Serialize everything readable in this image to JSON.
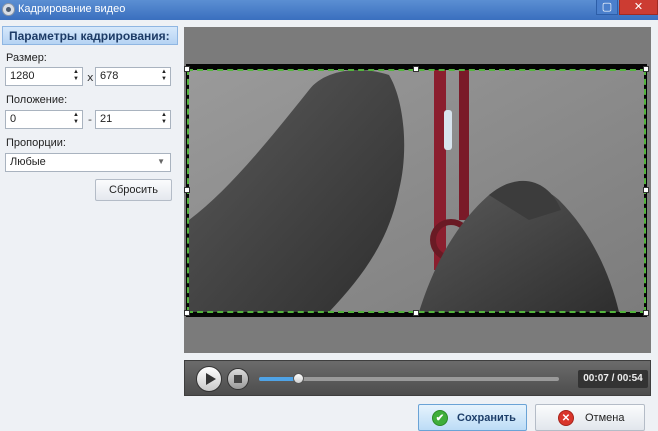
{
  "window": {
    "title": "Кадрирование видео",
    "controls": {
      "maximize_icon": "maximize-icon",
      "close_icon": "close-icon"
    }
  },
  "panel": {
    "header": "Параметры кадрирования:",
    "size": {
      "label": "Размер:",
      "width": "1280",
      "separator": "x",
      "height": "678"
    },
    "position": {
      "label": "Положение:",
      "x": "0",
      "separator": "-",
      "y": "21"
    },
    "proportions": {
      "label": "Пропорции:",
      "selected": "Любые"
    },
    "reset_label": "Сбросить"
  },
  "player": {
    "timecode": "00:07 / 00:54",
    "progress_fraction": 0.13
  },
  "footer": {
    "save_label": "Сохранить",
    "cancel_label": "Отмена"
  },
  "colors": {
    "crop_border": "#53b43d",
    "progress": "#4fa3e6",
    "titlebar": "#3a6fbf"
  }
}
